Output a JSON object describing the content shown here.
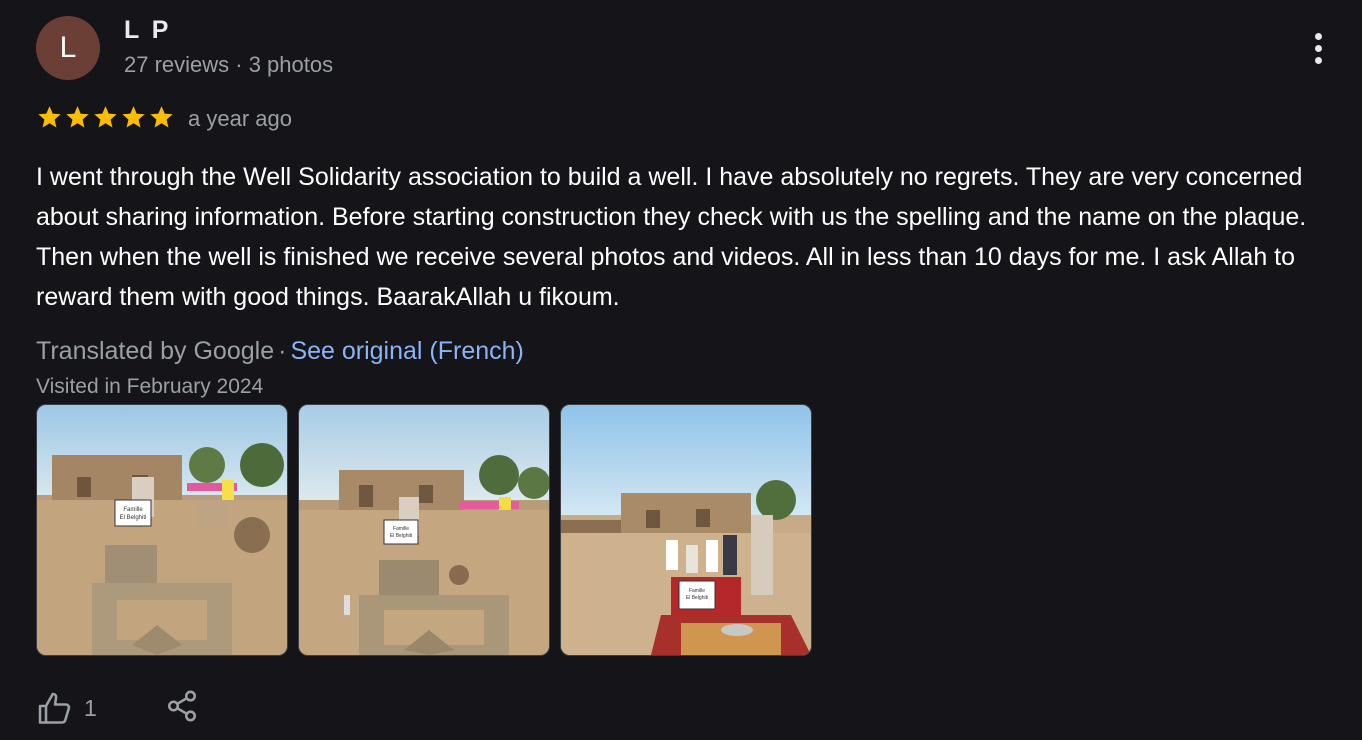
{
  "review": {
    "author": {
      "initial": "L",
      "name": "L P",
      "meta": "27 reviews · 3 photos",
      "avatar_color": "#6b3e36"
    },
    "rating": 5,
    "star_color": "#fbbc04",
    "time": "a year ago",
    "text": "I went through the Well Solidarity association to build a well. I have absolutely no regrets. They are very concerned about sharing information. Before starting construction they check with us the spelling and the name on the plaque. Then when the well is finished we receive several photos and videos. All in less than 10 days for me. I ask Allah to reward them with good things. BaarakAllah u fikoum.",
    "translation": {
      "translated_label": "Translated by Google",
      "separator": "·",
      "see_original_label": "See original (French)",
      "link_color": "#8ab4f8"
    },
    "visited": "Visited in February 2024",
    "photos": [
      {
        "plaque_line1": "Famille",
        "plaque_line2": "El Belghiti"
      },
      {
        "plaque_line1": "Famille",
        "plaque_line2": "El Belghiti"
      },
      {
        "plaque_line1": "Famille",
        "plaque_line2": "El Belghiti"
      }
    ],
    "actions": {
      "like_icon": "thumb-up-icon",
      "like_count": "1",
      "share_icon": "share-icon"
    }
  }
}
